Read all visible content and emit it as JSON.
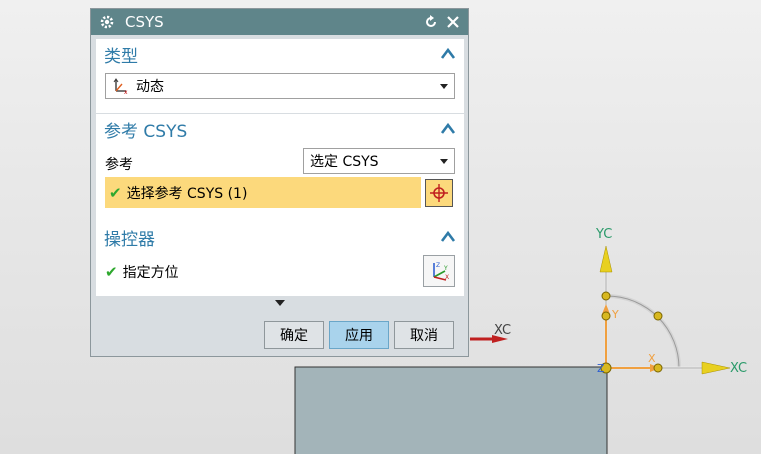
{
  "dialog": {
    "title": "CSYS",
    "title_icon": "gear-icon",
    "reset_icon": "reset-icon",
    "close_icon": "close-icon"
  },
  "groups": {
    "type": {
      "title": "类型",
      "selected": "动态",
      "selected_icon": "dynamic-csys-icon"
    },
    "reference": {
      "title": "参考 CSYS",
      "ref_label": "参考",
      "ref_selected": "选定 CSYS",
      "select_label": "选择参考 CSYS (1)",
      "select_icon": "crosshair-icon"
    },
    "manipulator": {
      "title": "操控器",
      "orient_label": "指定方位",
      "orient_icon": "csys-orient-icon"
    }
  },
  "footer": {
    "ok": "确定",
    "apply": "应用",
    "cancel": "取消"
  },
  "viewport": {
    "xc": "XC",
    "yc": "YC",
    "x": "X",
    "y": "Y",
    "z": "Z",
    "xc_small": "XC"
  },
  "colors": {
    "title_bar": "#5f858a",
    "group_title": "#2f7ba8",
    "selection_highlight": "#fcd97c",
    "apply_button": "#a9d3ec",
    "axis_yellow": "#e8d020",
    "axis_orange": "#f0a040",
    "block": "#a3b4b9"
  }
}
